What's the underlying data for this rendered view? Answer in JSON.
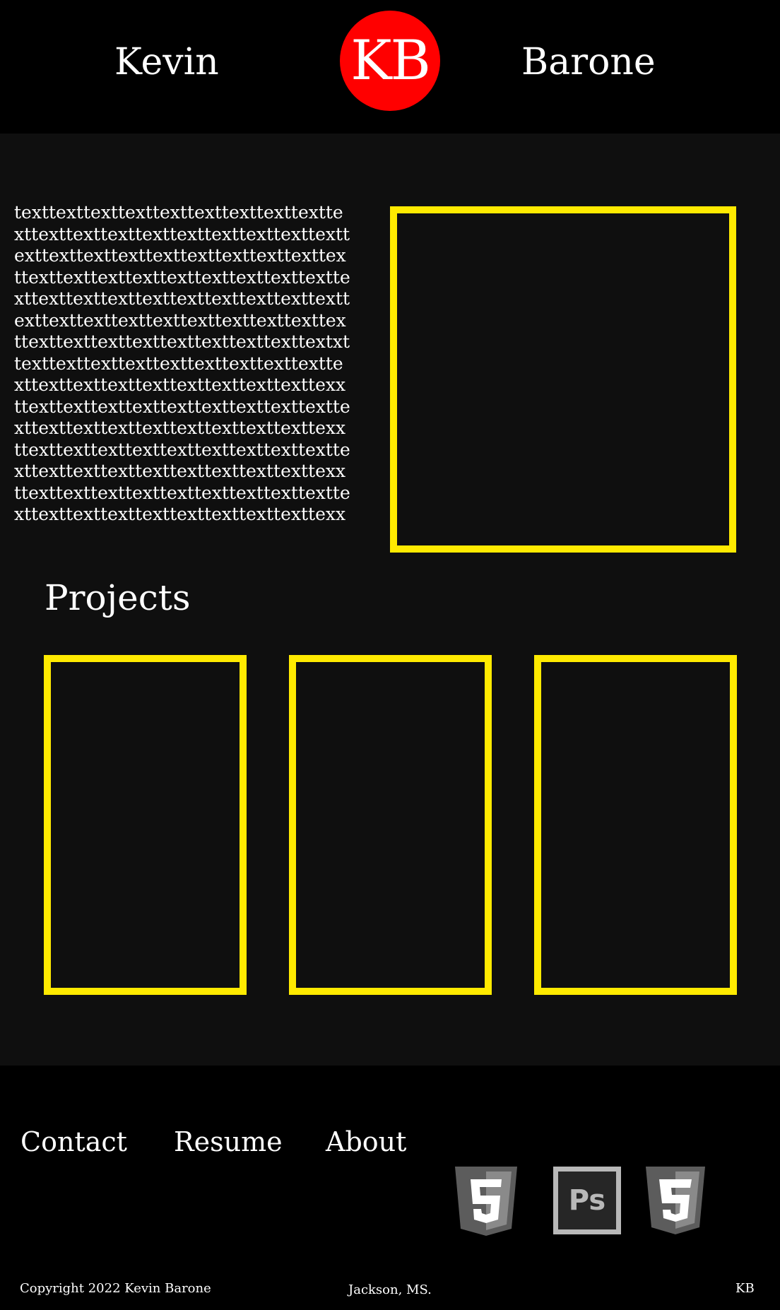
{
  "header": {
    "first_name": "Kevin",
    "last_name": "Barone",
    "logo_text": "KB"
  },
  "intro": {
    "lines": [
      "texttexttexttexttexttexttexttexttextte",
      "xttexttexttexttexttexttexttexttexttextt",
      "exttexttexttexttexttexttexttexttexttex",
      "ttexttexttexttexttexttexttexttexttextte",
      "xttexttexttexttexttexttexttexttexttextt",
      "exttexttexttexttexttexttexttexttexttex",
      "ttexttexttexttexttexttexttexttexttextxt",
      "texttexttexttexttexttexttexttexttextte",
      "xttexttexttexttexttexttexttexttexttexx",
      "ttexttexttexttexttexttexttexttexttextte",
      "xttexttexttexttexttexttexttexttexttexx",
      "ttexttexttexttexttexttexttexttexttextte",
      "xttexttexttexttexttexttexttexttexttexx",
      "ttexttexttexttexttexttexttexttexttextte",
      "xttexttexttexttexttexttexttexttexttexx"
    ]
  },
  "projects": {
    "heading": "Projects"
  },
  "footer": {
    "links": [
      "Contact",
      "Resume",
      "About"
    ],
    "icons": [
      "html5-icon",
      "photoshop-icon",
      "css3-icon"
    ],
    "photoshop_label": "Ps",
    "copyright": "Copyright 2022 Kevin Barone",
    "location": "Jackson, MS.",
    "initials": "KB"
  },
  "colors": {
    "accent_yellow": "#ffea00",
    "logo_red": "#ff0000",
    "header_bg": "#000000",
    "body_bg": "#0f0f0f",
    "icon_gray": "#8a8a8a"
  }
}
